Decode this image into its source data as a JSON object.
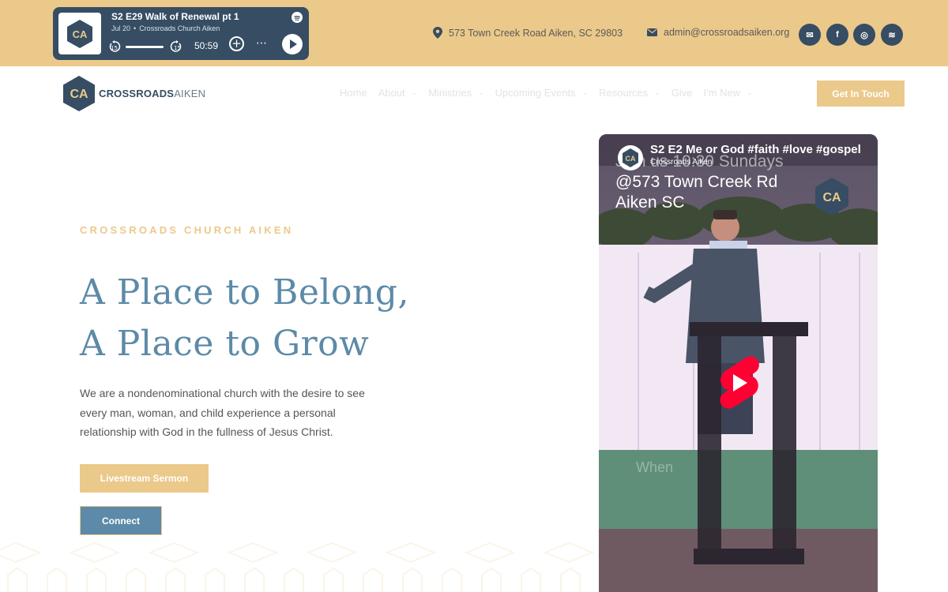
{
  "player": {
    "episode_title": "S2 E29 Walk of Renewal pt 1",
    "date": "Jul 20",
    "show": "Crossroads Church Aiken",
    "duration": "50:59",
    "skip_back": "15",
    "skip_forward": "15",
    "more": "⋯",
    "add": "+"
  },
  "contact": {
    "address": "573 Town Creek Road Aiken, SC 29803",
    "email": "admin@crossroadsaiken.org"
  },
  "social": [
    {
      "icon": "envelope-icon",
      "glyph": "✉"
    },
    {
      "icon": "facebook-icon",
      "glyph": "f"
    },
    {
      "icon": "instagram-icon",
      "glyph": "◎"
    },
    {
      "icon": "spotify-icon",
      "glyph": "≋"
    }
  ],
  "logo": {
    "bold": "CROSSROADS",
    "light": "AIKEN",
    "mark": "CA"
  },
  "nav": {
    "items": [
      {
        "label": "Home",
        "dropdown": false
      },
      {
        "label": "About",
        "dropdown": true
      },
      {
        "label": "Ministries",
        "dropdown": true
      },
      {
        "label": "Upcoming Events",
        "dropdown": true
      },
      {
        "label": "Resources",
        "dropdown": true
      },
      {
        "label": "Give",
        "dropdown": false
      },
      {
        "label": "I'm New",
        "dropdown": true
      }
    ],
    "cta": "Get In Touch"
  },
  "hero": {
    "eyebrow": "CROSSROADS CHURCH AIKEN",
    "headline": "A Place to Belong, A Place to Grow",
    "description": "We are a nondenominational church with the desire to see every man, woman, and child experience a personal relationship with God in the fullness of Jesus Christ.",
    "primary_button": "Livestream Sermon",
    "secondary_button": "Connect"
  },
  "video": {
    "title": "S2 E2 Me or God #faith #love #gospel",
    "channel": "Crossroads Aiken",
    "overlay_line1": "Join us 10:30 Sundays",
    "overlay_line2": "@573 Town Creek Rd",
    "overlay_line3": "Aiken SC",
    "caption": "When"
  },
  "colors": {
    "gold": "#ebc98a",
    "navy": "#364d63",
    "blue": "#5c8aa8",
    "youtube_red": "#ff0033"
  }
}
